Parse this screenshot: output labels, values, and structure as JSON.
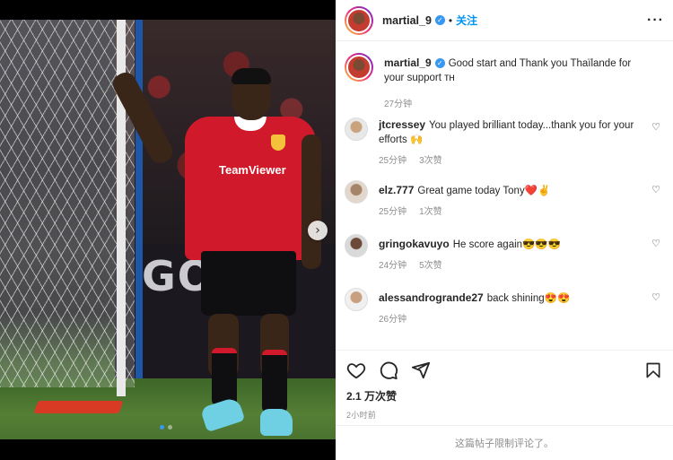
{
  "post": {
    "username": "martial_9",
    "follow_label": "关注",
    "separator": "•",
    "more_label": "···",
    "carousel_next": "›"
  },
  "caption": {
    "username": "martial_9",
    "text": "Good start and Thank you Thaïlande for your support ᴛʜ",
    "time": "27分钟"
  },
  "comments": [
    {
      "username": "jtcressey",
      "text": "You played brilliant today...thank you for your efforts 🙌",
      "time": "25分钟",
      "likes": "3次赞"
    },
    {
      "username": "elz.777",
      "text": "Great game today Tony❤️✌️",
      "time": "25分钟",
      "likes": "1次赞"
    },
    {
      "username": "gringokavuyo",
      "text": "He score again😎😎😎",
      "time": "24分钟",
      "likes": "5次赞"
    },
    {
      "username": "alessandrogrande27",
      "text": "back shining😍😍",
      "time": "26分钟",
      "likes": ""
    }
  ],
  "stats": {
    "likes": "2.1 万次赞",
    "time": "2小时前"
  },
  "footer": {
    "comments_limited": "这篇帖子限制评论了。"
  },
  "photo": {
    "sponsor": "TeamViewer",
    "adboard": "GOAL"
  },
  "icons": [
    "heart-icon",
    "comment-icon",
    "share-icon",
    "bookmark-icon",
    "verified-badge-icon",
    "chevron-right-icon"
  ],
  "colors": {
    "accent": "#0095f6",
    "verified": "#3897f0",
    "shirt": "#d0192a",
    "muted": "#8e8e8e"
  },
  "carousel": {
    "total": 2,
    "active": 1
  }
}
